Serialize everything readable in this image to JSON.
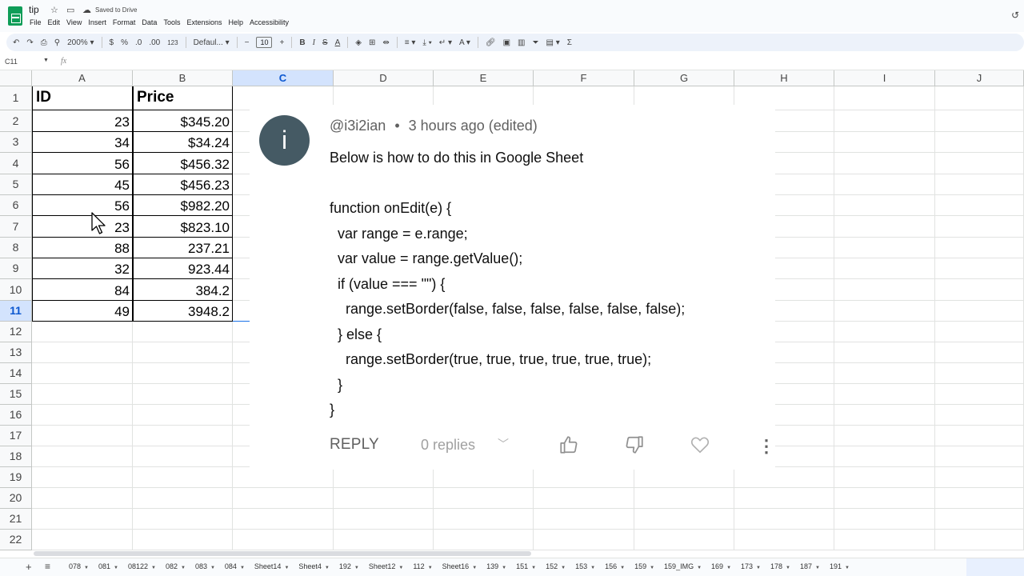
{
  "app": {
    "title": "tip",
    "saved_status": "Saved to Drive",
    "menu": [
      "File",
      "Edit",
      "View",
      "Insert",
      "Format",
      "Data",
      "Tools",
      "Extensions",
      "Help",
      "Accessibility"
    ]
  },
  "toolbar": {
    "zoom": "200%",
    "currency": "$",
    "percent": "%",
    "decrease_decimal": ".0",
    "increase_decimal": ".00",
    "number_format": "123",
    "font": "Defaul...",
    "font_size": "10",
    "bold": "B",
    "italic": "I",
    "strikethrough": "S",
    "text_color": "A",
    "functions": "Σ"
  },
  "formula_bar": {
    "cell_ref": "C11",
    "fx": "fx",
    "content": ""
  },
  "grid": {
    "columns": [
      "A",
      "B",
      "C",
      "D",
      "E",
      "F",
      "G",
      "H",
      "I",
      "J"
    ],
    "active_column": "C",
    "rows": [
      "1",
      "2",
      "3",
      "4",
      "5",
      "6",
      "7",
      "8",
      "9",
      "10",
      "11",
      "12",
      "13",
      "14",
      "15",
      "16",
      "17",
      "18",
      "19",
      "20",
      "21",
      "22"
    ],
    "active_row": "11",
    "headers": [
      "ID",
      "Price"
    ],
    "data": [
      [
        "23",
        "$345.20"
      ],
      [
        "34",
        "$34.24"
      ],
      [
        "56",
        "$456.32"
      ],
      [
        "45",
        "$456.23"
      ],
      [
        "56",
        "$982.20"
      ],
      [
        "23",
        "$823.10"
      ],
      [
        "88",
        "237.21"
      ],
      [
        "32",
        "923.44"
      ],
      [
        "84",
        "384.2"
      ],
      [
        "49",
        "3948.2"
      ]
    ]
  },
  "comment": {
    "avatar_letter": "i",
    "author": "@i3i2ian",
    "separator": "•",
    "time": "3 hours ago (edited)",
    "body": "Below is how to do this in Google Sheet\n\nfunction onEdit(e) {\n  var range = e.range;\n  var value = range.getValue();\n  if (value === \"\") {\n    range.setBorder(false, false, false, false, false, false);\n  } else {\n    range.setBorder(true, true, true, true, true, true);\n  }\n}",
    "reply_label": "REPLY",
    "replies_label": "0 replies"
  },
  "sheet_tabs": [
    "078",
    "081",
    "08122",
    "082",
    "083",
    "084",
    "Sheet14",
    "Sheet4",
    "192",
    "Sheet12",
    "112",
    "Sheet16",
    "139",
    "151",
    "152",
    "153",
    "156",
    "159",
    "159_IMG",
    "169",
    "173",
    "178",
    "187",
    "191"
  ]
}
